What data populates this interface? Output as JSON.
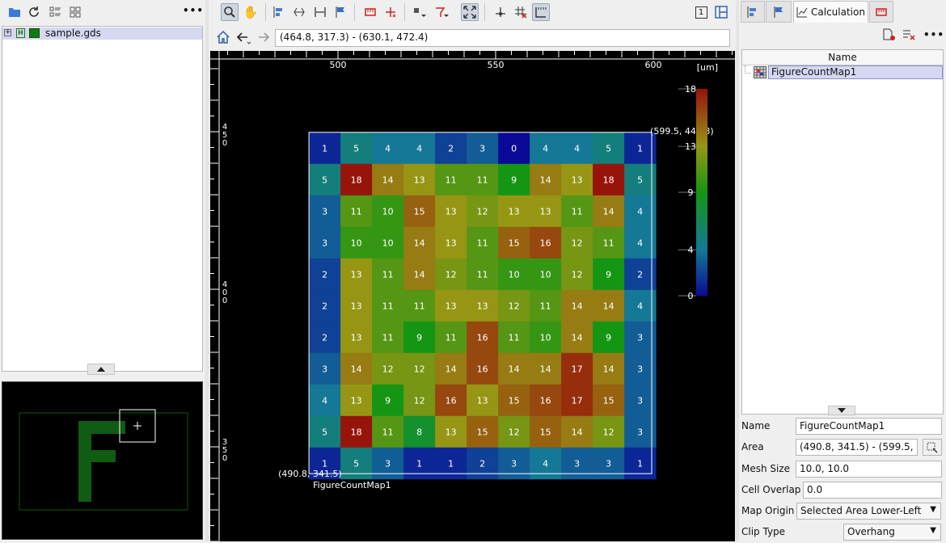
{
  "left_toolbar": {
    "icons": [
      "folder-open-icon",
      "refresh-icon",
      "layout-list-icon",
      "layout-grid-icon"
    ],
    "more_label": "•••"
  },
  "tree": {
    "items": [
      {
        "label": "sample.gds",
        "expander": "+",
        "badge": "H"
      }
    ]
  },
  "nav_bar": {
    "coordinates": "(464.8, 317.3) - (630.1, 472.4)"
  },
  "canvas": {
    "unit_label": "[um]",
    "x_ticks": [
      {
        "value": 500,
        "label": "500"
      },
      {
        "value": 550,
        "label": "550"
      },
      {
        "value": 600,
        "label": "600"
      }
    ],
    "y_ticks": [
      {
        "value": 450,
        "label": "450"
      },
      {
        "value": 400,
        "label": "400"
      },
      {
        "value": 350,
        "label": "350"
      }
    ],
    "map_name": "FigureCountMap1",
    "corner_top_right": "(599.5, 449.8)",
    "corner_bottom_left": "(490.8, 341.5)",
    "grid": [
      [
        1,
        5,
        4,
        4,
        2,
        3,
        0,
        4,
        4,
        5,
        1
      ],
      [
        5,
        18,
        14,
        13,
        11,
        11,
        9,
        14,
        13,
        18,
        5
      ],
      [
        3,
        11,
        10,
        15,
        13,
        12,
        13,
        13,
        11,
        14,
        4
      ],
      [
        3,
        10,
        10,
        14,
        13,
        11,
        15,
        16,
        12,
        11,
        4
      ],
      [
        2,
        13,
        11,
        14,
        12,
        11,
        10,
        10,
        12,
        9,
        2
      ],
      [
        2,
        13,
        11,
        11,
        13,
        13,
        12,
        11,
        14,
        14,
        4
      ],
      [
        2,
        13,
        11,
        9,
        11,
        16,
        11,
        10,
        14,
        9,
        3
      ],
      [
        3,
        14,
        12,
        12,
        14,
        16,
        14,
        14,
        17,
        14,
        3
      ],
      [
        4,
        13,
        9,
        12,
        16,
        13,
        15,
        16,
        17,
        15,
        3
      ],
      [
        5,
        18,
        11,
        8,
        13,
        15,
        12,
        15,
        14,
        12,
        3
      ],
      [
        1,
        5,
        3,
        1,
        1,
        2,
        3,
        4,
        3,
        3,
        1
      ]
    ],
    "legend": {
      "min": 0,
      "max": 18,
      "labels": [
        "18",
        "13",
        "9",
        "4",
        "0"
      ],
      "values": [
        18,
        13,
        9,
        4,
        0
      ]
    },
    "colors": {
      "background": "#000000",
      "low": "#0a1a8c",
      "high": "#8c1a0a",
      "outline": "#ffffff"
    }
  },
  "right_panel": {
    "tabs": [
      {
        "label": "",
        "icon": "layout-icon"
      },
      {
        "label": "",
        "icon": "flag-icon"
      },
      {
        "label": "Calculation",
        "icon": "chart-icon"
      },
      {
        "label": "",
        "icon": "ruler-icon"
      }
    ],
    "table_header": "Name",
    "rows": [
      {
        "label": "FigureCountMap1"
      }
    ],
    "properties": {
      "name_label": "Name",
      "name_value": "FigureCountMap1",
      "area_label": "Area",
      "area_value": "(490.8, 341.5) - (599.5,",
      "mesh_label": "Mesh Size",
      "mesh_value": "10.0, 10.0",
      "overlap_label": "Cell Overlap",
      "overlap_value": "0.0",
      "origin_label": "Map Origin",
      "origin_value": "Selected Area Lower-Left",
      "clip_label": "Clip Type",
      "clip_value": "Overhang"
    },
    "more_label": "•••"
  },
  "view_toolbar": {
    "page_label": "1"
  }
}
